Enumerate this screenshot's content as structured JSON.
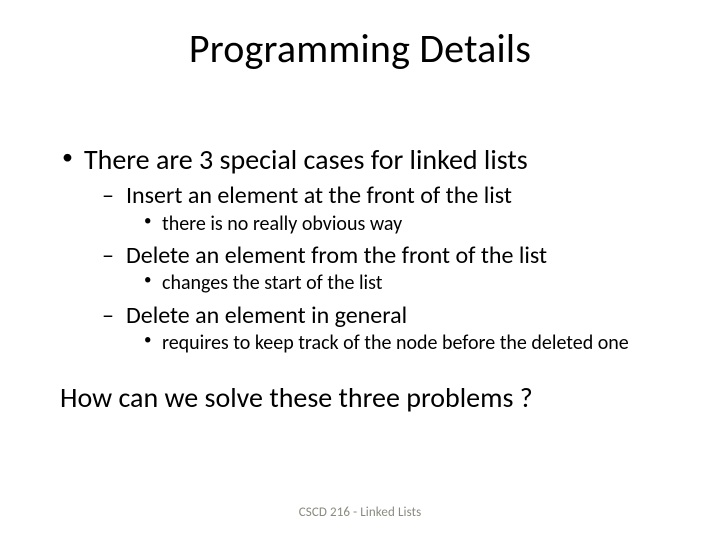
{
  "title": "Programming Details",
  "bullets": {
    "l1": "There are 3 special cases for linked lists",
    "case1": {
      "heading": "Insert an element at the front of the list",
      "note": "there is no really obvious way"
    },
    "case2": {
      "heading": "Delete an element from the front of the list",
      "note": "changes the start of the list"
    },
    "case3": {
      "heading": "Delete an element in general",
      "note": "requires to keep track of the node before the deleted one"
    }
  },
  "closing": "How can we solve these three problems ?",
  "footer": "CSCD 216 - Linked Lists"
}
